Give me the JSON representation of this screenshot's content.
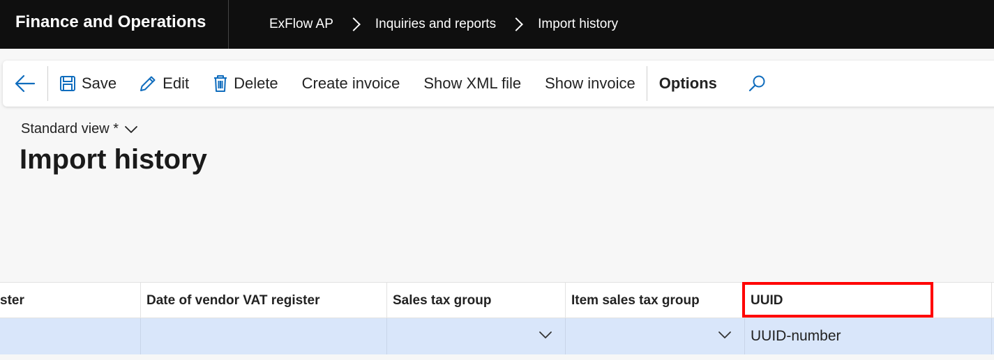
{
  "app": {
    "title": "Finance and Operations"
  },
  "breadcrumb": [
    "ExFlow AP",
    "Inquiries and reports",
    "Import history"
  ],
  "toolbar": {
    "save": "Save",
    "edit": "Edit",
    "delete": "Delete",
    "create_invoice": "Create invoice",
    "show_xml": "Show XML file",
    "show_invoice": "Show invoice",
    "options": "Options"
  },
  "view": {
    "name": "Standard view *"
  },
  "page": {
    "title": "Import history"
  },
  "grid": {
    "columns": [
      "ster",
      "Date of vendor VAT register",
      "Sales tax group",
      "Item sales tax group",
      "UUID"
    ],
    "row": {
      "uuid": "UUID-number"
    }
  },
  "colors": {
    "highlight": "#ff0000",
    "row_selected": "#d9e6fa",
    "topbar": "#0f0f0f",
    "accent": "#0f6cbd"
  }
}
